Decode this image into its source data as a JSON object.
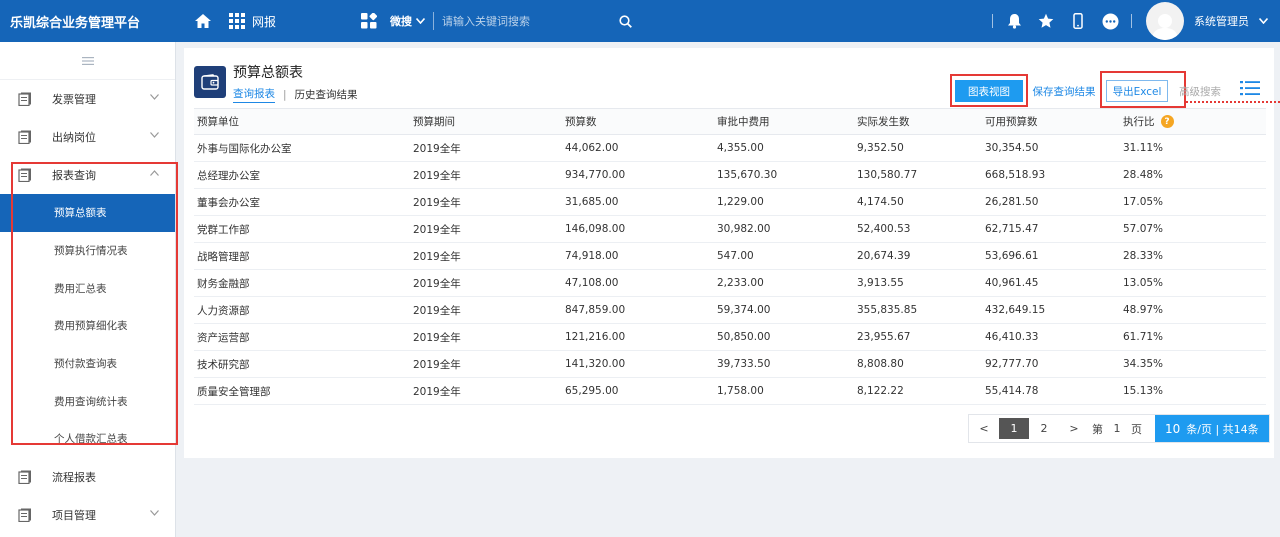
{
  "app": {
    "title": "乐凯综合业务管理平台",
    "nav_label": "网报",
    "search": {
      "scope": "微搜",
      "placeholder": "请输入关键词搜索"
    },
    "user_name": "系统管理员"
  },
  "sidebar": {
    "items": [
      {
        "label": "发票管理"
      },
      {
        "label": "出纳岗位"
      },
      {
        "label": "报表查询"
      }
    ],
    "subitems": [
      {
        "label": "预算总额表"
      },
      {
        "label": "预算执行情况表"
      },
      {
        "label": "费用汇总表"
      },
      {
        "label": "费用预算细化表"
      },
      {
        "label": "预付款查询表"
      },
      {
        "label": "费用查询统计表"
      },
      {
        "label": "个人借款汇总表"
      }
    ],
    "bottom_items": [
      {
        "label": "流程报表"
      },
      {
        "label": "项目管理"
      }
    ]
  },
  "main": {
    "title": "预算总额表",
    "tabs": [
      {
        "label": "查询报表"
      },
      {
        "label": "历史查询结果"
      }
    ],
    "actions": {
      "chart_view": "图表视图",
      "save_query": "保存查询结果",
      "export_excel": "导出Excel",
      "advanced_search": "高级搜索"
    },
    "table": {
      "columns": [
        "预算单位",
        "预算期间",
        "预算数",
        "审批中费用",
        "实际发生数",
        "可用预算数",
        "执行比"
      ],
      "rows": [
        [
          "外事与国际化办公室",
          "2019全年",
          "44,062.00",
          "4,355.00",
          "9,352.50",
          "30,354.50",
          "31.11%"
        ],
        [
          "总经理办公室",
          "2019全年",
          "934,770.00",
          "135,670.30",
          "130,580.77",
          "668,518.93",
          "28.48%"
        ],
        [
          "董事会办公室",
          "2019全年",
          "31,685.00",
          "1,229.00",
          "4,174.50",
          "26,281.50",
          "17.05%"
        ],
        [
          "党群工作部",
          "2019全年",
          "146,098.00",
          "30,982.00",
          "52,400.53",
          "62,715.47",
          "57.07%"
        ],
        [
          "战略管理部",
          "2019全年",
          "74,918.00",
          "547.00",
          "20,674.39",
          "53,696.61",
          "28.33%"
        ],
        [
          "财务金融部",
          "2019全年",
          "47,108.00",
          "2,233.00",
          "3,913.55",
          "40,961.45",
          "13.05%"
        ],
        [
          "人力资源部",
          "2019全年",
          "847,859.00",
          "59,374.00",
          "355,835.85",
          "432,649.15",
          "48.97%"
        ],
        [
          "资产运营部",
          "2019全年",
          "121,216.00",
          "50,850.00",
          "23,955.67",
          "46,410.33",
          "61.71%"
        ],
        [
          "技术研究部",
          "2019全年",
          "141,320.00",
          "39,733.50",
          "8,808.80",
          "92,777.70",
          "34.35%"
        ],
        [
          "质量安全管理部",
          "2019全年",
          "65,295.00",
          "1,758.00",
          "8,122.22",
          "55,414.78",
          "15.13%"
        ]
      ]
    },
    "pagination": {
      "prev": "<",
      "pages": [
        "1",
        "2"
      ],
      "next": ">",
      "goto_prefix": "第",
      "goto_value": "1",
      "goto_suffix": "页",
      "page_size": "10",
      "page_size_label": "条/页 | 共14条"
    }
  }
}
